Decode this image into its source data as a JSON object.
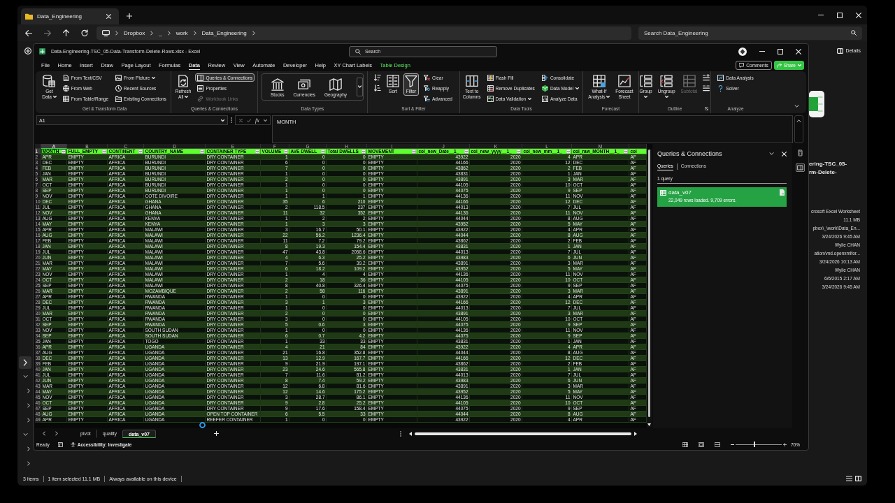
{
  "explorer": {
    "tab": {
      "title": "Data_Engineering"
    },
    "breadcrumb": [
      "Dropbox",
      "_",
      "work",
      "Data_Engineering"
    ],
    "search": {
      "placeholder": "Search Data_Engineering"
    },
    "details_button": "Details",
    "nav_tree": [
      {
        "expanded": false,
        "selected": true
      },
      {
        "expanded": true,
        "selected": false,
        "children": [
          {
            "expanded": false,
            "selected": false
          },
          {
            "expanded": false,
            "selected": false
          },
          {
            "expanded": false,
            "selected": false
          }
        ]
      },
      {
        "expanded": true,
        "selected": false,
        "children": [
          {
            "expanded": false,
            "selected": false
          },
          {
            "expanded": false,
            "selected": false
          }
        ]
      }
    ],
    "details": {
      "name_lines": [
        "ering-TSC_05-",
        "rm-Delete-"
      ],
      "values": [
        "crosoft Excel Worksheet",
        "11.1 MB",
        "pbox\\_\\work\\Data_En...",
        "3/24/2026 9:45 AM",
        "Wylie CHAN",
        "ation/vnd.openxmlfor...",
        "3/24/2026 10:13 AM",
        "Wylie CHAN",
        "6/6/2015 2:17 AM",
        "3/24/2026 9:45 AM"
      ]
    },
    "status": [
      "3 items",
      "1 item selected 11.1 MB",
      "Always available on this device"
    ]
  },
  "excel": {
    "title": "Data-Engineering-TSC_05-Data-Transform-Delete-Rows.xlsx - Excel",
    "search": {
      "placeholder": "Search"
    },
    "menu_tabs": [
      {
        "label": "File",
        "kind": "standard",
        "selected": false
      },
      {
        "label": "Home",
        "kind": "standard",
        "selected": false
      },
      {
        "label": "Insert",
        "kind": "standard",
        "selected": false
      },
      {
        "label": "Draw",
        "kind": "standard",
        "selected": false
      },
      {
        "label": "Page Layout",
        "kind": "standard",
        "selected": false
      },
      {
        "label": "Formulas",
        "kind": "standard",
        "selected": false
      },
      {
        "label": "Data",
        "kind": "standard",
        "selected": true
      },
      {
        "label": "Review",
        "kind": "standard",
        "selected": false
      },
      {
        "label": "View",
        "kind": "standard",
        "selected": false
      },
      {
        "label": "Automate",
        "kind": "standard",
        "selected": false
      },
      {
        "label": "Developer",
        "kind": "standard",
        "selected": false
      },
      {
        "label": "Help",
        "kind": "standard",
        "selected": false
      },
      {
        "label": "XY Chart Labels",
        "kind": "standard",
        "selected": false
      },
      {
        "label": "Table Design",
        "kind": "contextual",
        "selected": false
      }
    ],
    "comments_button": "Comments",
    "share_button": "Share",
    "ribbon": [
      {
        "title": "Get & Transform Data",
        "launcher": false,
        "items": [
          {
            "kind": "large",
            "lines": [
              "Get",
              "Data"
            ],
            "dropdown": true,
            "disabled": false,
            "selected": false
          },
          {
            "kind": "small",
            "label": "From Text/CSV",
            "dropdown": false,
            "disabled": false,
            "selected": false
          },
          {
            "kind": "small",
            "label": "From Web",
            "dropdown": false,
            "disabled": false,
            "selected": false
          },
          {
            "kind": "small",
            "label": "From Table/Range",
            "dropdown": false,
            "disabled": false,
            "selected": false
          },
          {
            "kind": "small",
            "label": "From Picture",
            "dropdown": true,
            "disabled": false,
            "selected": false
          },
          {
            "kind": "small",
            "label": "Recent Sources",
            "dropdown": false,
            "disabled": false,
            "selected": false
          },
          {
            "kind": "small",
            "label": "Existing Connections",
            "dropdown": false,
            "disabled": false,
            "selected": false
          }
        ]
      },
      {
        "title": "Queries & Connections",
        "launcher": false,
        "items": [
          {
            "kind": "large",
            "lines": [
              "Refresh",
              "All"
            ],
            "dropdown": true,
            "disabled": false,
            "selected": false
          },
          {
            "kind": "small",
            "label": "Queries & Connections",
            "dropdown": false,
            "disabled": false,
            "selected": true
          },
          {
            "kind": "small",
            "label": "Properties",
            "dropdown": false,
            "disabled": false,
            "selected": false
          },
          {
            "kind": "small",
            "label": "Workbook Links",
            "dropdown": false,
            "disabled": true,
            "selected": false
          }
        ]
      },
      {
        "title": "Data Types",
        "launcher": false,
        "items": [
          {
            "kind": "gallery",
            "label": "Stocks",
            "dropdown": false,
            "disabled": false,
            "selected": false
          },
          {
            "kind": "gallery",
            "label": "Currencies",
            "dropdown": false,
            "disabled": false,
            "selected": false
          },
          {
            "kind": "gallery",
            "label": "Geography",
            "dropdown": false,
            "disabled": false,
            "selected": false
          }
        ]
      },
      {
        "title": "Sort & Filter",
        "launcher": false,
        "items": [
          {
            "kind": "icon",
            "dropdown": false,
            "disabled": false,
            "selected": false
          },
          {
            "kind": "icon",
            "dropdown": false,
            "disabled": false,
            "selected": false
          },
          {
            "kind": "large",
            "lines": [
              "Sort"
            ],
            "dropdown": false,
            "disabled": false,
            "selected": false
          },
          {
            "kind": "large",
            "lines": [
              "Filter"
            ],
            "dropdown": false,
            "disabled": false,
            "selected": true
          },
          {
            "kind": "small",
            "label": "Clear",
            "dropdown": false,
            "disabled": false,
            "selected": false
          },
          {
            "kind": "small",
            "label": "Reapply",
            "dropdown": false,
            "disabled": false,
            "selected": false
          },
          {
            "kind": "small",
            "label": "Advanced",
            "dropdown": false,
            "disabled": false,
            "selected": false
          }
        ]
      },
      {
        "title": "Data Tools",
        "launcher": false,
        "items": [
          {
            "kind": "large",
            "lines": [
              "Text to",
              "Columns"
            ],
            "dropdown": false,
            "disabled": false,
            "selected": false
          },
          {
            "kind": "small",
            "label": "Flash Fill",
            "dropdown": false,
            "disabled": false,
            "selected": false
          },
          {
            "kind": "small",
            "label": "Remove Duplicates",
            "dropdown": false,
            "disabled": false,
            "selected": false
          },
          {
            "kind": "small",
            "label": "Data Validation",
            "dropdown": true,
            "disabled": false,
            "selected": false
          },
          {
            "kind": "small",
            "label": "Consolidate",
            "dropdown": false,
            "disabled": false,
            "selected": false
          },
          {
            "kind": "small",
            "label": "Data Model",
            "dropdown": true,
            "disabled": false,
            "selected": false
          },
          {
            "kind": "small",
            "label": "Analyze Data",
            "dropdown": false,
            "disabled": false,
            "selected": false
          }
        ]
      },
      {
        "title": "Forecast",
        "launcher": false,
        "items": [
          {
            "kind": "large",
            "lines": [
              "What-If",
              "Analysis"
            ],
            "dropdown": true,
            "disabled": false,
            "selected": false
          },
          {
            "kind": "large",
            "lines": [
              "Forecast",
              "Sheet"
            ],
            "dropdown": false,
            "disabled": false,
            "selected": false
          }
        ]
      },
      {
        "title": "Outline",
        "launcher": true,
        "items": [
          {
            "kind": "large",
            "lines": [
              "Group"
            ],
            "dropdown": true,
            "disabled": false,
            "selected": false
          },
          {
            "kind": "large",
            "lines": [
              "Ungroup"
            ],
            "dropdown": true,
            "disabled": false,
            "selected": false
          },
          {
            "kind": "large",
            "lines": [
              "Subtotal"
            ],
            "dropdown": false,
            "disabled": true,
            "selected": false
          },
          {
            "kind": "icon",
            "dropdown": false,
            "disabled": false,
            "selected": false
          },
          {
            "kind": "icon",
            "dropdown": false,
            "disabled": false,
            "selected": false
          }
        ]
      },
      {
        "title": "Analyze",
        "launcher": false,
        "items": [
          {
            "kind": "small",
            "label": "Data Analysis",
            "dropdown": false,
            "disabled": false,
            "selected": false
          },
          {
            "kind": "small",
            "label": "Solver",
            "dropdown": false,
            "disabled": false,
            "selected": false
          }
        ]
      }
    ],
    "formula_bar": {
      "name_box": "A1",
      "function_label": "fx",
      "formula": "MONTH"
    },
    "sheet": {
      "columns": [
        {
          "letter": "A",
          "kind": "text",
          "selected": true
        },
        {
          "letter": "B",
          "kind": "text",
          "selected": false
        },
        {
          "letter": "C",
          "kind": "text",
          "selected": false
        },
        {
          "letter": "D",
          "kind": "text",
          "selected": false
        },
        {
          "letter": "E",
          "kind": "text",
          "selected": false
        },
        {
          "letter": "F",
          "kind": "number",
          "selected": false
        },
        {
          "letter": "G",
          "kind": "number",
          "selected": false
        },
        {
          "letter": "H",
          "kind": "number",
          "selected": false
        },
        {
          "letter": "I",
          "kind": "text",
          "selected": false
        },
        {
          "letter": "J",
          "kind": "number",
          "selected": false
        },
        {
          "letter": "K",
          "kind": "number",
          "selected": false
        },
        {
          "letter": "L",
          "kind": "number",
          "selected": false
        },
        {
          "letter": "M",
          "kind": "text",
          "selected": false
        },
        {
          "kind": "text",
          "selected": false
        }
      ],
      "header": {
        "number": "1",
        "selected": true,
        "cells": [
          {
            "text": "MONTH",
            "filter": true,
            "selected": true
          },
          {
            "text": "FULL_EMPTY",
            "filter": true,
            "selected": false
          },
          {
            "text": "CONTINENT",
            "filter": true,
            "selected": false
          },
          {
            "text": "COUNTRY_NAME",
            "filter": true,
            "selected": false
          },
          {
            "text": "CONTAINER TYPE",
            "filter": true,
            "selected": false
          },
          {
            "text": "VOLUME",
            "filter": true,
            "selected": false
          },
          {
            "text": "AVE DWELL",
            "filter": true,
            "selected": false
          },
          {
            "text": "Total DWELLS",
            "filter": true,
            "selected": false
          },
          {
            "text": "MOVEMENT",
            "filter": true,
            "selected": false
          },
          {
            "text": "col_new_Date__1_",
            "filter": true,
            "selected": false
          },
          {
            "text": "col_new_yyyy__1_",
            "filter": true,
            "selected": false
          },
          {
            "text": "col_new_mm__1_",
            "filter": true,
            "selected": false
          },
          {
            "text": "col_raw_MONTH__1_",
            "filter": true,
            "selected": false
          },
          {
            "text": "col",
            "filter": false,
            "selected": false
          }
        ]
      },
      "rows": [
        {
          "number": "2",
          "selected": false,
          "cells": [
            "APR",
            "EMPTY",
            "AFRICA",
            "BURUNDI",
            "DRY CONTAINER",
            "1",
            "0",
            "0",
            "EMPTY",
            "43922",
            "2020",
            "4",
            "APR",
            "AF"
          ]
        },
        {
          "number": "3",
          "selected": false,
          "cells": [
            "DEC",
            "EMPTY",
            "AFRICA",
            "BURUNDI",
            "DRY CONTAINER",
            "6",
            "0",
            "0",
            "EMPTY",
            "44166",
            "2020",
            "12",
            "DEC",
            "AF"
          ]
        },
        {
          "number": "4",
          "selected": false,
          "cells": [
            "FEB",
            "EMPTY",
            "AFRICA",
            "BURUNDI",
            "DRY CONTAINER",
            "7",
            "0",
            "0",
            "EMPTY",
            "43862",
            "2020",
            "2",
            "FEB",
            "AF"
          ]
        },
        {
          "number": "5",
          "selected": false,
          "cells": [
            "JAN",
            "EMPTY",
            "AFRICA",
            "BURUNDI",
            "DRY CONTAINER",
            "1",
            "0",
            "0",
            "EMPTY",
            "43831",
            "2020",
            "1",
            "JAN",
            "AF"
          ]
        },
        {
          "number": "6",
          "selected": false,
          "cells": [
            "MAR",
            "EMPTY",
            "AFRICA",
            "BURUNDI",
            "DRY CONTAINER",
            "2",
            "0",
            "0",
            "EMPTY",
            "43891",
            "2020",
            "3",
            "MAR",
            "AF"
          ]
        },
        {
          "number": "7",
          "selected": false,
          "cells": [
            "OCT",
            "EMPTY",
            "AFRICA",
            "BURUNDI",
            "DRY CONTAINER",
            "1",
            "0",
            "0",
            "EMPTY",
            "44105",
            "2020",
            "10",
            "OCT",
            "AF"
          ]
        },
        {
          "number": "8",
          "selected": false,
          "cells": [
            "SEP",
            "EMPTY",
            "AFRICA",
            "BURUNDI",
            "DRY CONTAINER",
            "1",
            "0",
            "0",
            "EMPTY",
            "44075",
            "2020",
            "9",
            "SEP",
            "AF"
          ]
        },
        {
          "number": "9",
          "selected": false,
          "cells": [
            "NOV",
            "EMPTY",
            "AFRICA",
            "COTE DIVOIRE",
            "DRY CONTAINER",
            "1",
            "1",
            "1",
            "EMPTY",
            "44136",
            "2020",
            "11",
            "NOV",
            "AF"
          ]
        },
        {
          "number": "10",
          "selected": false,
          "cells": [
            "DEC",
            "EMPTY",
            "AFRICA",
            "GHANA",
            "DRY CONTAINER",
            "35",
            "6",
            "210",
            "EMPTY",
            "44166",
            "2020",
            "12",
            "DEC",
            "AF"
          ]
        },
        {
          "number": "11",
          "selected": false,
          "cells": [
            "JUL",
            "EMPTY",
            "AFRICA",
            "GHANA",
            "DRY CONTAINER",
            "2",
            "118.5",
            "237",
            "EMPTY",
            "44013",
            "2020",
            "7",
            "JUL",
            "AF"
          ]
        },
        {
          "number": "12",
          "selected": false,
          "cells": [
            "NOV",
            "EMPTY",
            "AFRICA",
            "GHANA",
            "DRY CONTAINER",
            "11",
            "32",
            "352",
            "EMPTY",
            "44136",
            "2020",
            "11",
            "NOV",
            "AF"
          ]
        },
        {
          "number": "13",
          "selected": false,
          "cells": [
            "AUG",
            "EMPTY",
            "AFRICA",
            "KENYA",
            "DRY CONTAINER",
            "1",
            "2",
            "2",
            "EMPTY",
            "44044",
            "2020",
            "8",
            "AUG",
            "AF"
          ]
        },
        {
          "number": "14",
          "selected": false,
          "cells": [
            "MAY",
            "EMPTY",
            "AFRICA",
            "KENYA",
            "DRY CONTAINER",
            "1",
            "3",
            "3",
            "EMPTY",
            "43952",
            "2020",
            "5",
            "MAY",
            "AF"
          ]
        },
        {
          "number": "15",
          "selected": false,
          "cells": [
            "APR",
            "EMPTY",
            "AFRICA",
            "MALAWI",
            "DRY CONTAINER",
            "3",
            "16.7",
            "50.1",
            "EMPTY",
            "43922",
            "2020",
            "4",
            "APR",
            "AF"
          ]
        },
        {
          "number": "16",
          "selected": false,
          "cells": [
            "AUG",
            "EMPTY",
            "AFRICA",
            "MALAWI",
            "DRY CONTAINER",
            "22",
            "56.2",
            "1236.4",
            "EMPTY",
            "44044",
            "2020",
            "8",
            "AUG",
            "AF"
          ]
        },
        {
          "number": "17",
          "selected": false,
          "cells": [
            "FEB",
            "EMPTY",
            "AFRICA",
            "MALAWI",
            "DRY CONTAINER",
            "11",
            "7.2",
            "79.2",
            "EMPTY",
            "43862",
            "2020",
            "2",
            "FEB",
            "AF"
          ]
        },
        {
          "number": "18",
          "selected": false,
          "cells": [
            "JAN",
            "EMPTY",
            "AFRICA",
            "MALAWI",
            "DRY CONTAINER",
            "8",
            "19.3",
            "154.4",
            "EMPTY",
            "43831",
            "2020",
            "1",
            "JAN",
            "AF"
          ]
        },
        {
          "number": "19",
          "selected": false,
          "cells": [
            "JUL",
            "EMPTY",
            "AFRICA",
            "MALAWI",
            "DRY CONTAINER",
            "47",
            "43.8",
            "2058.6",
            "EMPTY",
            "44013",
            "2020",
            "7",
            "JUL",
            "AF"
          ]
        },
        {
          "number": "20",
          "selected": false,
          "cells": [
            "JUN",
            "EMPTY",
            "AFRICA",
            "MALAWI",
            "DRY CONTAINER",
            "4",
            "6.3",
            "25.2",
            "EMPTY",
            "43983",
            "2020",
            "6",
            "JUN",
            "AF"
          ]
        },
        {
          "number": "21",
          "selected": false,
          "cells": [
            "MAR",
            "EMPTY",
            "AFRICA",
            "MALAWI",
            "DRY CONTAINER",
            "7",
            "5.6",
            "39.2",
            "EMPTY",
            "43891",
            "2020",
            "3",
            "MAR",
            "AF"
          ]
        },
        {
          "number": "22",
          "selected": false,
          "cells": [
            "MAY",
            "EMPTY",
            "AFRICA",
            "MALAWI",
            "DRY CONTAINER",
            "6",
            "18.2",
            "109.2",
            "EMPTY",
            "43952",
            "2020",
            "5",
            "MAY",
            "AF"
          ]
        },
        {
          "number": "23",
          "selected": false,
          "cells": [
            "NOV",
            "EMPTY",
            "AFRICA",
            "MALAWI",
            "DRY CONTAINER",
            "1",
            "4",
            "4",
            "EMPTY",
            "44136",
            "2020",
            "11",
            "NOV",
            "AF"
          ]
        },
        {
          "number": "24",
          "selected": false,
          "cells": [
            "OCT",
            "EMPTY",
            "AFRICA",
            "MALAWI",
            "DRY CONTAINER",
            "2",
            "18",
            "36",
            "EMPTY",
            "44105",
            "2020",
            "10",
            "OCT",
            "AF"
          ]
        },
        {
          "number": "25",
          "selected": false,
          "cells": [
            "SEP",
            "EMPTY",
            "AFRICA",
            "MALAWI",
            "DRY CONTAINER",
            "8",
            "40.8",
            "326.4",
            "EMPTY",
            "44075",
            "2020",
            "9",
            "SEP",
            "AF"
          ]
        },
        {
          "number": "26",
          "selected": false,
          "cells": [
            "MAR",
            "EMPTY",
            "AFRICA",
            "MOZAMBIQUE",
            "DRY CONTAINER",
            "2",
            "58",
            "116",
            "EMPTY",
            "43891",
            "2020",
            "3",
            "MAR",
            "AF"
          ]
        },
        {
          "number": "27",
          "selected": false,
          "cells": [
            "APR",
            "EMPTY",
            "AFRICA",
            "RWANDA",
            "DRY CONTAINER",
            "1",
            "0",
            "0",
            "EMPTY",
            "43922",
            "2020",
            "4",
            "APR",
            "AF"
          ]
        },
        {
          "number": "28",
          "selected": false,
          "cells": [
            "DEC",
            "EMPTY",
            "AFRICA",
            "RWANDA",
            "DRY CONTAINER",
            "3",
            "1",
            "3",
            "EMPTY",
            "44166",
            "2020",
            "12",
            "DEC",
            "AF"
          ]
        },
        {
          "number": "29",
          "selected": false,
          "cells": [
            "JUL",
            "EMPTY",
            "AFRICA",
            "RWANDA",
            "DRY CONTAINER",
            "1",
            "0",
            "0",
            "EMPTY",
            "44013",
            "2020",
            "7",
            "JUL",
            "AF"
          ]
        },
        {
          "number": "30",
          "selected": false,
          "cells": [
            "MAR",
            "EMPTY",
            "AFRICA",
            "RWANDA",
            "DRY CONTAINER",
            "2",
            "0",
            "0",
            "EMPTY",
            "43891",
            "2020",
            "3",
            "MAR",
            "AF"
          ]
        },
        {
          "number": "31",
          "selected": false,
          "cells": [
            "OCT",
            "EMPTY",
            "AFRICA",
            "RWANDA",
            "DRY CONTAINER",
            "3",
            "0",
            "0",
            "EMPTY",
            "44105",
            "2020",
            "10",
            "OCT",
            "AF"
          ]
        },
        {
          "number": "32",
          "selected": false,
          "cells": [
            "SEP",
            "EMPTY",
            "AFRICA",
            "RWANDA",
            "DRY CONTAINER",
            "5",
            "0.6",
            "3",
            "EMPTY",
            "44075",
            "2020",
            "9",
            "SEP",
            "AF"
          ]
        },
        {
          "number": "33",
          "selected": false,
          "cells": [
            "NOV",
            "EMPTY",
            "AFRICA",
            "SOUTH SUDAN",
            "DRY CONTAINER",
            "1",
            "0",
            "0",
            "EMPTY",
            "44136",
            "2020",
            "11",
            "NOV",
            "AF"
          ]
        },
        {
          "number": "34",
          "selected": false,
          "cells": [
            "SEP",
            "EMPTY",
            "AFRICA",
            "SOUTH SUDAN",
            "DRY CONTAINER",
            "6",
            "0.7",
            "4.2",
            "EMPTY",
            "44075",
            "2020",
            "9",
            "SEP",
            "AF"
          ]
        },
        {
          "number": "35",
          "selected": false,
          "cells": [
            "JAN",
            "EMPTY",
            "AFRICA",
            "TOGO",
            "DRY CONTAINER",
            "1",
            "33",
            "33",
            "EMPTY",
            "43831",
            "2020",
            "1",
            "JAN",
            "AF"
          ]
        },
        {
          "number": "36",
          "selected": false,
          "cells": [
            "APR",
            "EMPTY",
            "AFRICA",
            "UGANDA",
            "DRY CONTAINER",
            "4",
            "21",
            "84",
            "EMPTY",
            "43922",
            "2020",
            "4",
            "APR",
            "AF"
          ]
        },
        {
          "number": "37",
          "selected": false,
          "cells": [
            "AUG",
            "EMPTY",
            "AFRICA",
            "UGANDA",
            "DRY CONTAINER",
            "21",
            "16.8",
            "352.8",
            "EMPTY",
            "44044",
            "2020",
            "8",
            "AUG",
            "AF"
          ]
        },
        {
          "number": "38",
          "selected": false,
          "cells": [
            "DEC",
            "EMPTY",
            "AFRICA",
            "UGANDA",
            "DRY CONTAINER",
            "13",
            "12.9",
            "167.7",
            "EMPTY",
            "44166",
            "2020",
            "12",
            "DEC",
            "AF"
          ]
        },
        {
          "number": "39",
          "selected": false,
          "cells": [
            "FEB",
            "EMPTY",
            "AFRICA",
            "UGANDA",
            "DRY CONTAINER",
            "9",
            "21.9",
            "197.1",
            "EMPTY",
            "43862",
            "2020",
            "2",
            "FEB",
            "AF"
          ]
        },
        {
          "number": "40",
          "selected": false,
          "cells": [
            "JAN",
            "EMPTY",
            "AFRICA",
            "UGANDA",
            "DRY CONTAINER",
            "23",
            "24.6",
            "565.8",
            "EMPTY",
            "43831",
            "2020",
            "1",
            "JAN",
            "AF"
          ]
        },
        {
          "number": "41",
          "selected": false,
          "cells": [
            "JUL",
            "EMPTY",
            "AFRICA",
            "UGANDA",
            "DRY CONTAINER",
            "7",
            "11.6",
            "81.2",
            "EMPTY",
            "44013",
            "2020",
            "7",
            "JUL",
            "AF"
          ]
        },
        {
          "number": "42",
          "selected": false,
          "cells": [
            "JUN",
            "EMPTY",
            "AFRICA",
            "UGANDA",
            "DRY CONTAINER",
            "8",
            "7.4",
            "59.2",
            "EMPTY",
            "43983",
            "2020",
            "6",
            "JUN",
            "AF"
          ]
        },
        {
          "number": "43",
          "selected": false,
          "cells": [
            "MAR",
            "EMPTY",
            "AFRICA",
            "UGANDA",
            "DRY CONTAINER",
            "12",
            "6.8",
            "81.6",
            "EMPTY",
            "43891",
            "2020",
            "3",
            "MAR",
            "AF"
          ]
        },
        {
          "number": "44",
          "selected": false,
          "cells": [
            "MAY",
            "EMPTY",
            "AFRICA",
            "UGANDA",
            "DRY CONTAINER",
            "12",
            "14.6",
            "175.2",
            "EMPTY",
            "43952",
            "2020",
            "5",
            "MAY",
            "AF"
          ]
        },
        {
          "number": "45",
          "selected": false,
          "cells": [
            "NOV",
            "EMPTY",
            "AFRICA",
            "UGANDA",
            "DRY CONTAINER",
            "3",
            "28.7",
            "86.1",
            "EMPTY",
            "44136",
            "2020",
            "11",
            "NOV",
            "AF"
          ]
        },
        {
          "number": "46",
          "selected": false,
          "cells": [
            "OCT",
            "EMPTY",
            "AFRICA",
            "UGANDA",
            "DRY CONTAINER",
            "9",
            "2.8",
            "25.2",
            "EMPTY",
            "44105",
            "2020",
            "10",
            "OCT",
            "AF"
          ]
        },
        {
          "number": "47",
          "selected": false,
          "cells": [
            "SEP",
            "EMPTY",
            "AFRICA",
            "UGANDA",
            "DRY CONTAINER",
            "9",
            "17.6",
            "158.4",
            "EMPTY",
            "44075",
            "2020",
            "9",
            "SEP",
            "AF"
          ]
        },
        {
          "number": "48",
          "selected": false,
          "cells": [
            "AUG",
            "EMPTY",
            "AFRICA",
            "UGANDA",
            "OPEN TOP CONTAINER",
            "6",
            "5.5",
            "33",
            "EMPTY",
            "44044",
            "2020",
            "8",
            "AUG",
            "AF"
          ]
        },
        {
          "number": "49",
          "selected": false,
          "cells": [
            "APR",
            "EMPTY",
            "AFRICA",
            "UGANDA",
            "REEFER CONTAINER",
            "1",
            "0",
            "0",
            "EMPTY",
            "43922",
            "2020",
            "4",
            "APR",
            "AF"
          ]
        }
      ]
    },
    "queries_pane": {
      "title": "Queries & Connections",
      "tabs": [
        {
          "label": "Queries",
          "selected": true
        },
        {
          "label": "Connections",
          "selected": false
        }
      ],
      "count": "1 query",
      "queries": [
        {
          "name": "data_v07",
          "status": "22,049 rows loaded. 9,709 errors.",
          "selected": true
        }
      ]
    },
    "side_buttons": [
      {
        "selected": false
      },
      {
        "selected": true
      }
    ],
    "sheet_tabs": [
      {
        "label": "pivot",
        "selected": false
      },
      {
        "label": "quality",
        "selected": false
      },
      {
        "label": "data_v07",
        "selected": true
      }
    ],
    "status_bar": {
      "mode": "Ready",
      "accessibility": "Accessibility: Investigate",
      "zoom": {
        "label": "70%",
        "level": 0.41
      }
    }
  }
}
